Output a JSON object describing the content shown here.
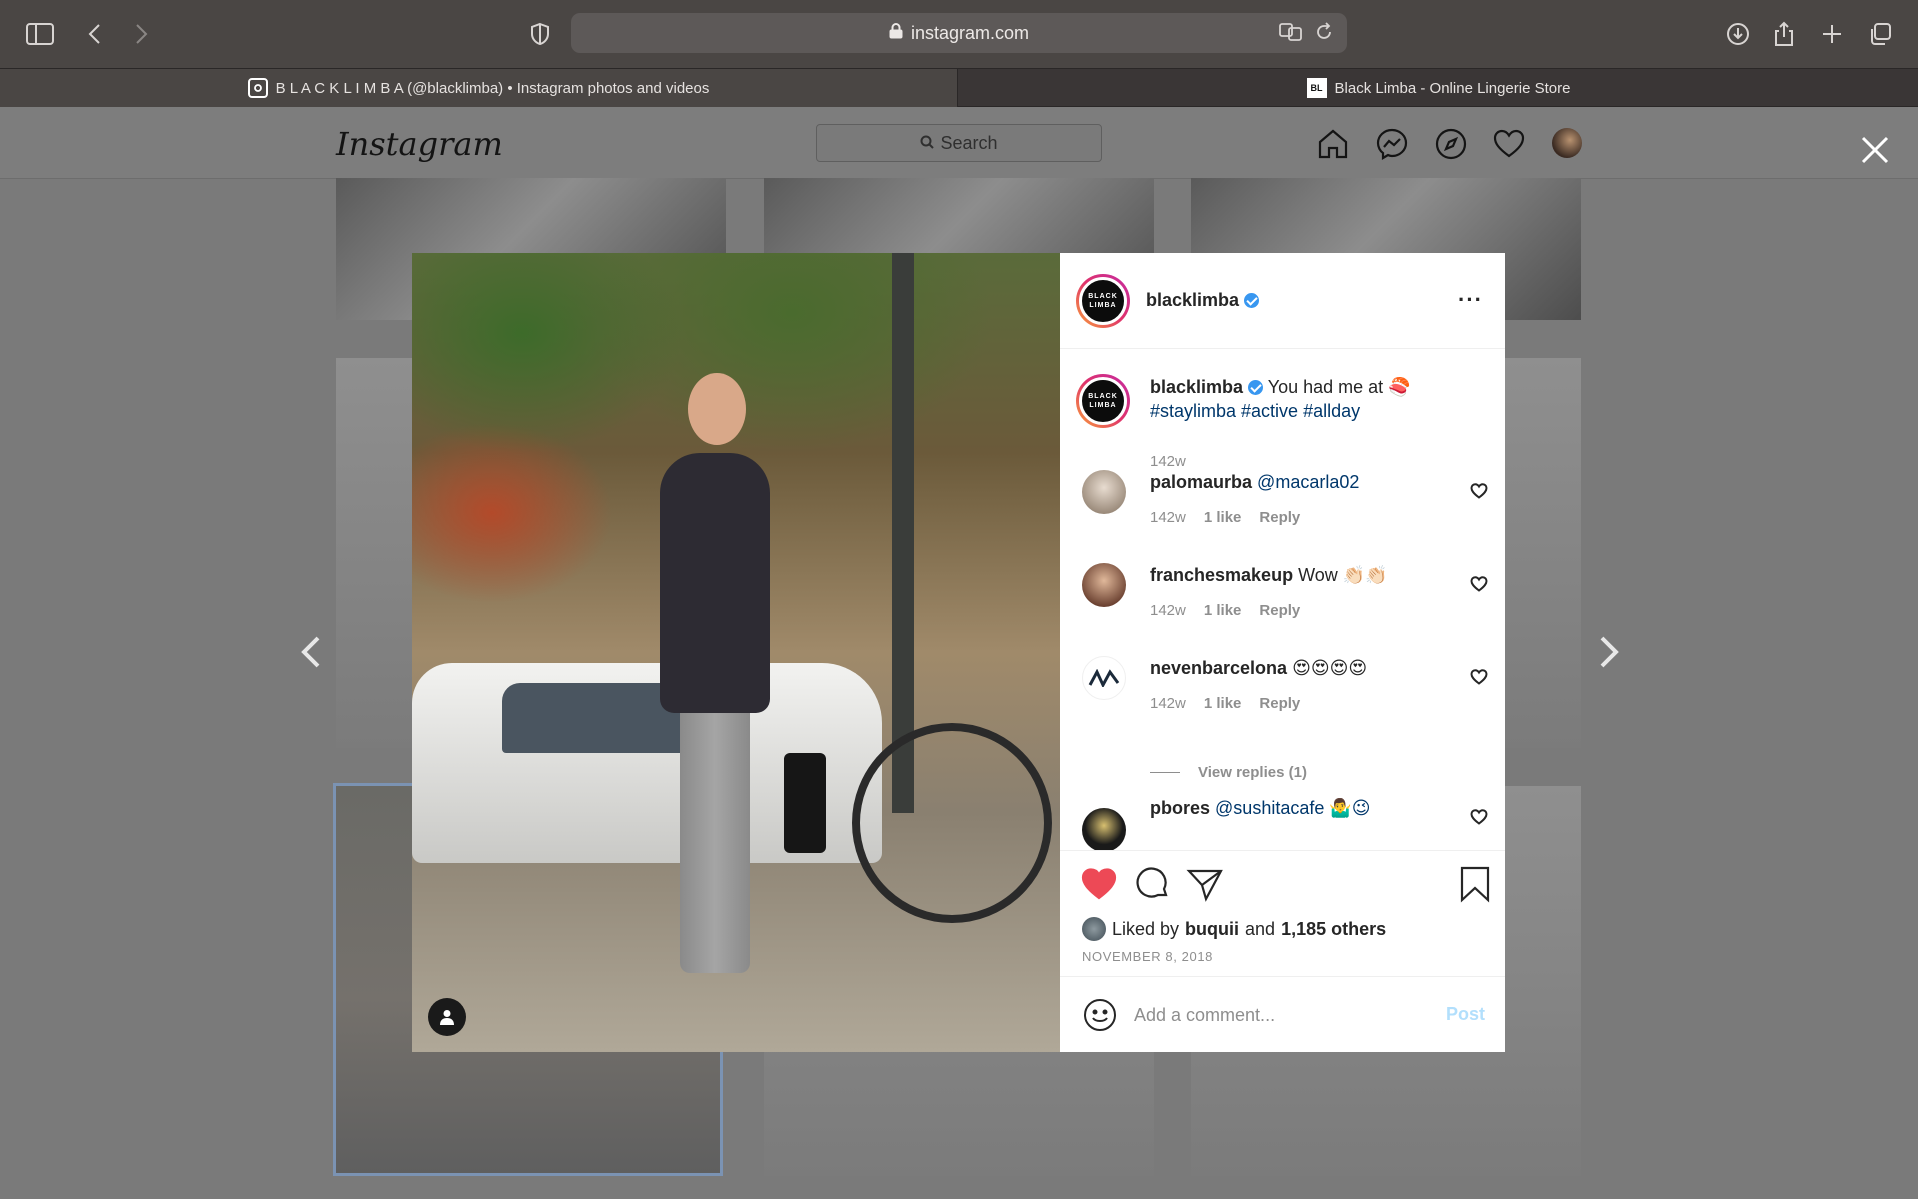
{
  "browser": {
    "url": "instagram.com",
    "tabs": [
      {
        "label": "B L A C K L I M B A (@blacklimba) • Instagram photos and videos",
        "active": true
      },
      {
        "label": "Black Limba - Online Lingerie Store",
        "active": false
      }
    ],
    "tab2_favicon": "BL"
  },
  "instagram": {
    "logo": "Instagram",
    "search_placeholder": "Search"
  },
  "post": {
    "account": "blacklimba",
    "avatar_text": "BLACK LIMBA",
    "caption": {
      "username": "blacklimba",
      "text": "You had me at 🍣",
      "hashtags": "#staylimba #active #allday",
      "time": "142w"
    },
    "comments": [
      {
        "username": "palomaurba",
        "text": "@macarla02",
        "text_is_link": true,
        "time": "142w",
        "likes": "1 like",
        "reply": "Reply"
      },
      {
        "username": "franchesmakeup",
        "text": "Wow 👏🏻👏🏻",
        "text_is_link": false,
        "time": "142w",
        "likes": "1 like",
        "reply": "Reply"
      },
      {
        "username": "nevenbarcelona",
        "text": "😍😍😍😍",
        "text_is_link": false,
        "time": "142w",
        "likes": "1 like",
        "reply": "Reply"
      },
      {
        "username": "pbores",
        "text": "@sushitacafe 🤷‍♂️😉",
        "text_is_link": true,
        "time": "",
        "likes": "",
        "reply": ""
      }
    ],
    "view_replies": "View replies (1)",
    "liked_by_prefix": "Liked by",
    "liked_by_user": "buquii",
    "liked_by_and": "and",
    "liked_by_others": "1,185 others",
    "date": "NOVEMBER 8, 2018",
    "comment_placeholder": "Add a comment...",
    "post_button": "Post",
    "liked": true
  },
  "colors": {
    "heart_liked": "#ed4956",
    "link": "#00376b",
    "verified": "#3897f0",
    "post_disabled": "#b2dffc"
  }
}
